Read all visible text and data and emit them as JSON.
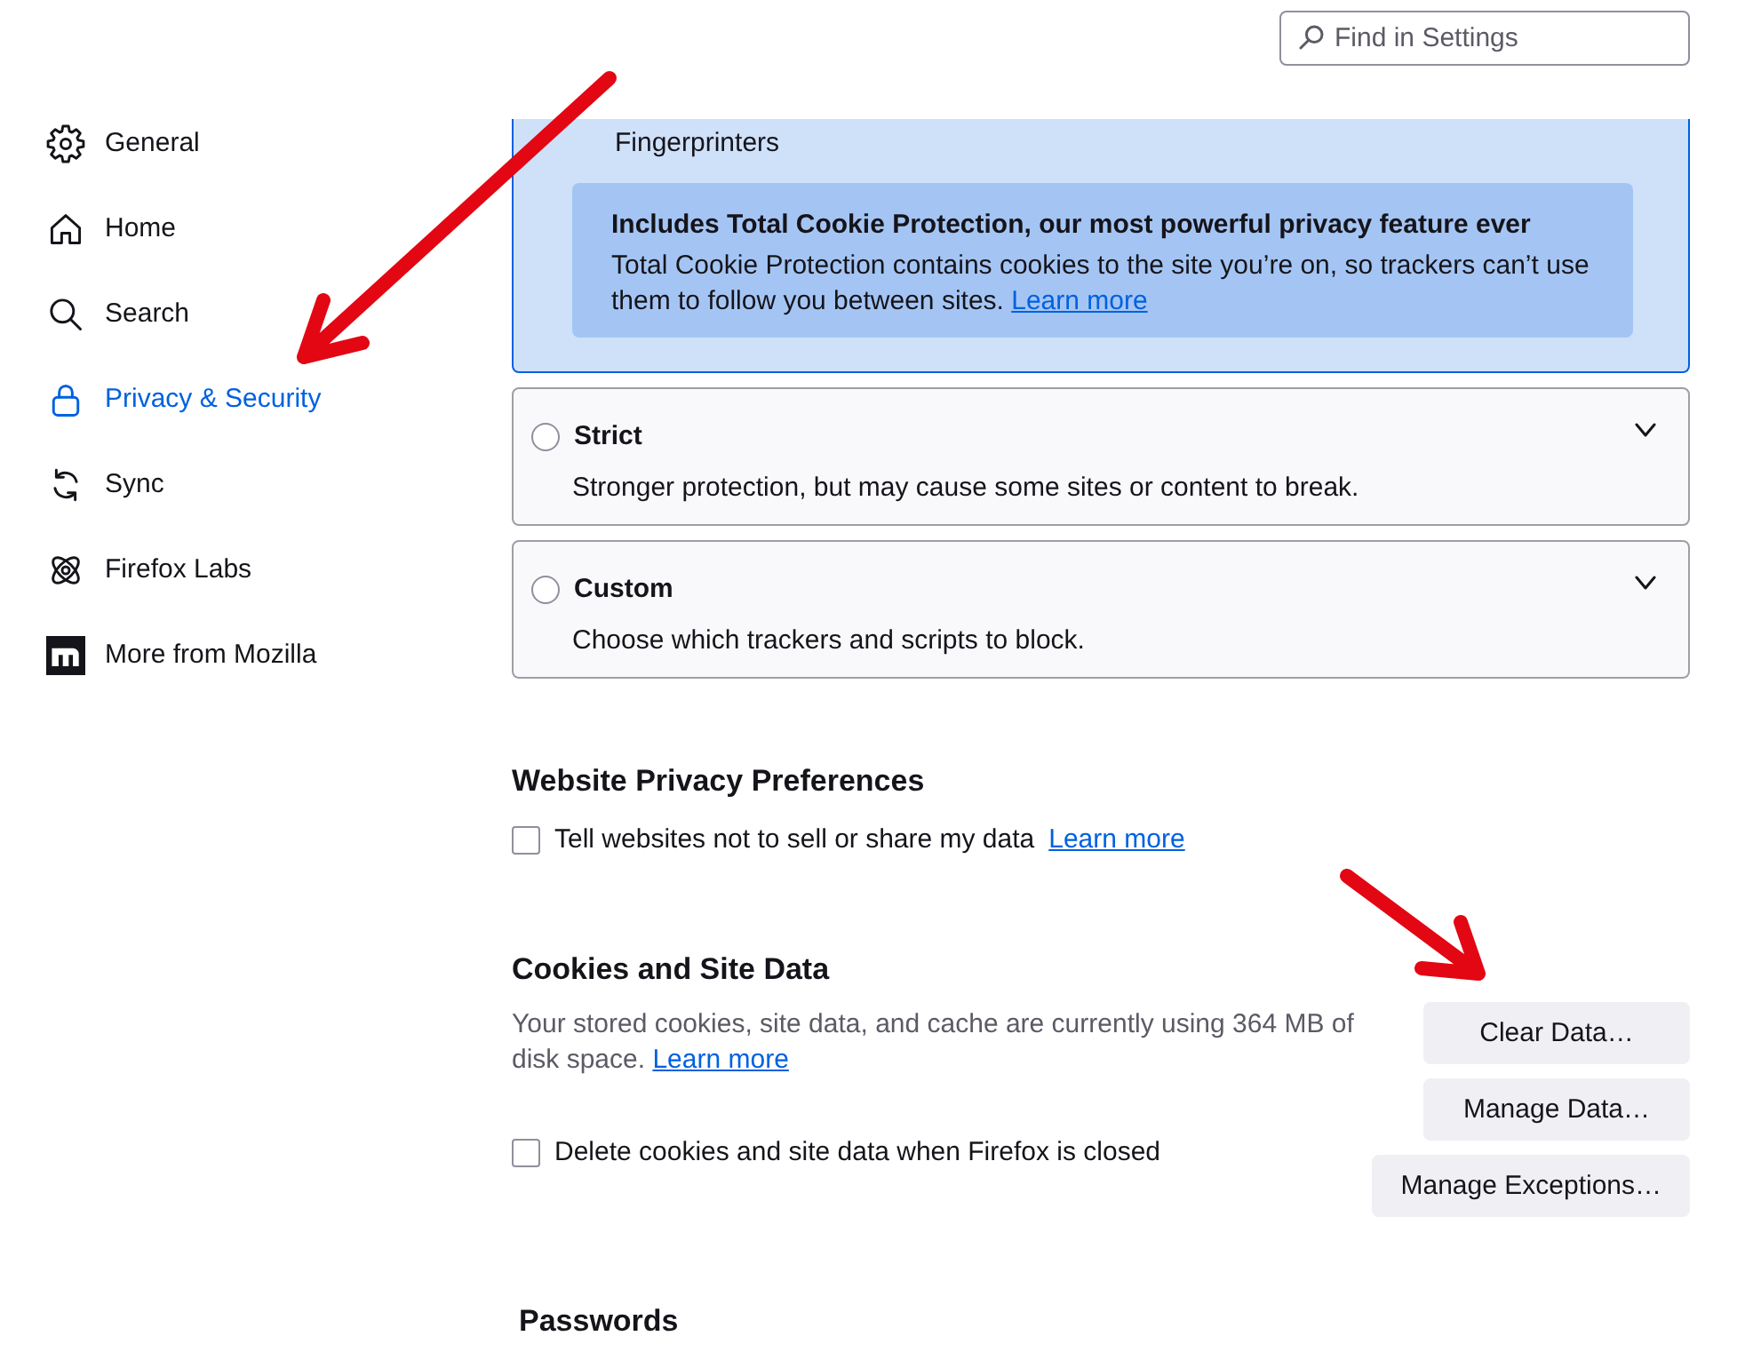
{
  "search": {
    "placeholder": "Find in Settings"
  },
  "sidebar": {
    "items": [
      {
        "label": "General",
        "selected": false
      },
      {
        "label": "Home",
        "selected": false
      },
      {
        "label": "Search",
        "selected": false
      },
      {
        "label": "Privacy & Security",
        "selected": true
      },
      {
        "label": "Sync",
        "selected": false
      },
      {
        "label": "Firefox Labs",
        "selected": false
      },
      {
        "label": "More from Mozilla",
        "selected": false
      }
    ]
  },
  "tracking_options": [
    {
      "selected": true,
      "expanded": true,
      "details": [
        "Fingerprinters"
      ],
      "callout": {
        "title": "Includes Total Cookie Protection, our most powerful privacy feature ever",
        "text": "Total Cookie Protection contains cookies to the site you’re on, so trackers can’t use them to follow you between sites.",
        "link": "Learn more"
      }
    },
    {
      "label": "Strict",
      "description": "Stronger protection, but may cause some sites or content to break.",
      "selected": false,
      "expanded": false
    },
    {
      "label": "Custom",
      "description": "Choose which trackers and scripts to block.",
      "selected": false,
      "expanded": false
    }
  ],
  "website_privacy": {
    "heading": "Website Privacy Preferences",
    "option": {
      "label": "Tell websites not to sell or share my data",
      "checked": false,
      "link": "Learn more"
    }
  },
  "cookies": {
    "heading": "Cookies and Site Data",
    "description": "Your stored cookies, site data, and cache are currently using 364 MB of disk space.",
    "link": "Learn more",
    "option": {
      "label": "Delete cookies and site data when Firefox is closed",
      "checked": false
    },
    "buttons": [
      "Clear Data…",
      "Manage Data…",
      "Manage Exceptions…"
    ]
  },
  "passwords": {
    "heading": "Passwords"
  }
}
